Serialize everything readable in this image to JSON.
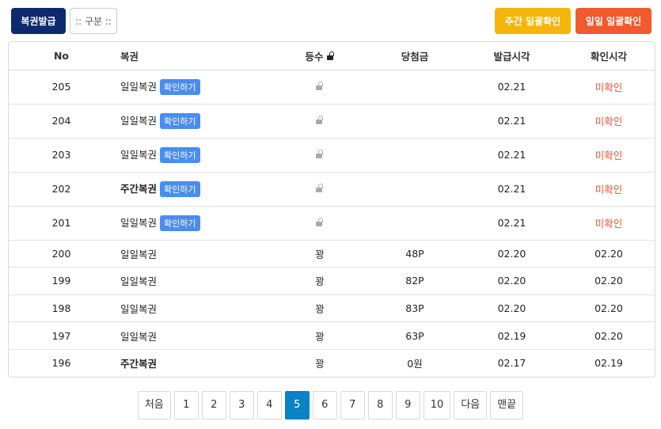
{
  "toolbar": {
    "issue_label": "복권발급",
    "category_label": ":: 구분 ::",
    "weekly_confirm_label": "주간 일괄확인",
    "daily_confirm_label": "일일 일괄확인"
  },
  "table": {
    "headers": {
      "no": "No",
      "name": "복권",
      "rank": "등수",
      "prize": "당첨금",
      "issued": "발급시각",
      "confirmed": "확인시각"
    },
    "confirm_badge": "확인하기",
    "rows": [
      {
        "no": "205",
        "name": "일일복권",
        "bold": false,
        "rank": "",
        "prize": "",
        "issued": "02.21",
        "confirmed": "미확인",
        "pending": true
      },
      {
        "no": "204",
        "name": "일일복권",
        "bold": false,
        "rank": "",
        "prize": "",
        "issued": "02.21",
        "confirmed": "미확인",
        "pending": true
      },
      {
        "no": "203",
        "name": "일일복권",
        "bold": false,
        "rank": "",
        "prize": "",
        "issued": "02.21",
        "confirmed": "미확인",
        "pending": true
      },
      {
        "no": "202",
        "name": "주간복권",
        "bold": true,
        "rank": "",
        "prize": "",
        "issued": "02.21",
        "confirmed": "미확인",
        "pending": true
      },
      {
        "no": "201",
        "name": "일일복권",
        "bold": false,
        "rank": "",
        "prize": "",
        "issued": "02.21",
        "confirmed": "미확인",
        "pending": true
      },
      {
        "no": "200",
        "name": "일일복권",
        "bold": false,
        "rank": "꽝",
        "prize": "48P",
        "issued": "02.20",
        "confirmed": "02.20",
        "pending": false
      },
      {
        "no": "199",
        "name": "일일복권",
        "bold": false,
        "rank": "꽝",
        "prize": "82P",
        "issued": "02.20",
        "confirmed": "02.20",
        "pending": false
      },
      {
        "no": "198",
        "name": "일일복권",
        "bold": false,
        "rank": "꽝",
        "prize": "83P",
        "issued": "02.20",
        "confirmed": "02.20",
        "pending": false
      },
      {
        "no": "197",
        "name": "일일복권",
        "bold": false,
        "rank": "꽝",
        "prize": "63P",
        "issued": "02.19",
        "confirmed": "02.20",
        "pending": false
      },
      {
        "no": "196",
        "name": "주간복권",
        "bold": true,
        "rank": "꽝",
        "prize": "0원",
        "issued": "02.17",
        "confirmed": "02.19",
        "pending": false
      }
    ]
  },
  "pagination": {
    "first": "처음",
    "pages": [
      "1",
      "2",
      "3",
      "4",
      "5",
      "6",
      "7",
      "8",
      "9",
      "10"
    ],
    "current": "5",
    "next": "다음",
    "last": "맨끝"
  },
  "colors": {
    "primary": "#0d2a6e",
    "weekly": "#f6b50c",
    "daily": "#f05a2c",
    "badge": "#4a8cf0",
    "unconfirmed": "#e8542f",
    "active_page": "#0a82c6"
  },
  "icons": {
    "rank_header": "lock-open-icon",
    "row_pending": "lock-open-icon"
  }
}
